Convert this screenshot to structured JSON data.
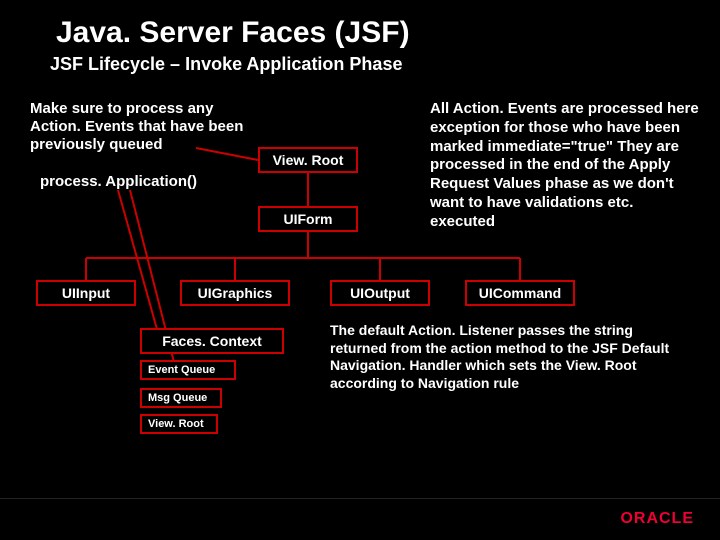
{
  "title": "Java. Server Faces (JSF)",
  "subtitle": "JSF Lifecycle – Invoke Application Phase",
  "textLeft": "Make sure to process any Action. Events that have been previously queued",
  "method": "process. Application()",
  "textRight": "All Action. Events are processed here exception for those who have been marked immediate=\"true\" They are processed in the end of the Apply Request Values phase as we don't want to have validations etc. executed",
  "boxes": {
    "viewroot": "View. Root",
    "uiform": "UIForm",
    "uiinput": "UIInput",
    "uigraphics": "UIGraphics",
    "uioutput": "UIOutput",
    "uicommand": "UICommand",
    "facescontext": "Faces. Context",
    "eventqueue": "Event Queue",
    "msgqueue": "Msg Queue",
    "viewroot2": "View. Root"
  },
  "bottomText": "The default Action. Listener passes the string returned from the action method to the JSF Default Navigation. Handler which sets the View. Root according to Navigation rule",
  "brand": "ORACLE"
}
